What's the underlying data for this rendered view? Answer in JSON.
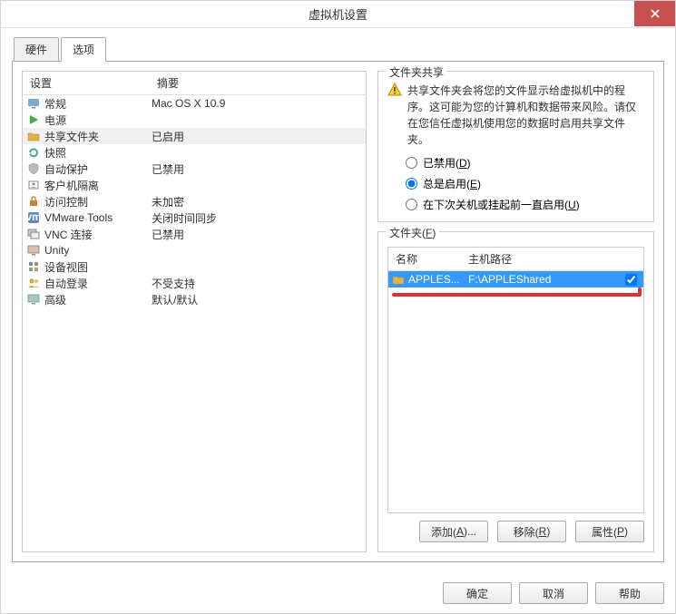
{
  "window": {
    "title": "虚拟机设置"
  },
  "tabs": {
    "hardware": "硬件",
    "options": "选项"
  },
  "columns": {
    "setting": "设置",
    "summary": "摘要"
  },
  "settings": [
    {
      "icon": "monitor",
      "label": "常规",
      "summary": "Mac OS X 10.9"
    },
    {
      "icon": "play",
      "label": "电源",
      "summary": ""
    },
    {
      "icon": "folder",
      "label": "共享文件夹",
      "summary": "已启用",
      "selected": true
    },
    {
      "icon": "snap",
      "label": "快照",
      "summary": ""
    },
    {
      "icon": "shield",
      "label": "自动保护",
      "summary": "已禁用"
    },
    {
      "icon": "guest",
      "label": "客户机隔离",
      "summary": ""
    },
    {
      "icon": "lock",
      "label": "访问控制",
      "summary": "未加密"
    },
    {
      "icon": "vmw",
      "label": "VMware Tools",
      "summary": "关闭时间同步"
    },
    {
      "icon": "vnc",
      "label": "VNC 连接",
      "summary": "已禁用"
    },
    {
      "icon": "unity",
      "label": "Unity",
      "summary": ""
    },
    {
      "icon": "dev",
      "label": "设备视图",
      "summary": ""
    },
    {
      "icon": "user",
      "label": "自动登录",
      "summary": "不受支持"
    },
    {
      "icon": "adv",
      "label": "高级",
      "summary": "默认/默认"
    }
  ],
  "share": {
    "group_title": "文件夹共享",
    "warning": "共享文件夹会将您的文件显示给虚拟机中的程序。这可能为您的计算机和数据带来风险。请仅在您信任虚拟机使用您的数据时启用共享文件夹。",
    "radios": {
      "disabled": {
        "label": "已禁用(",
        "key": "D",
        "suffix": ")"
      },
      "always": {
        "label": "总是启用(",
        "key": "E",
        "suffix": ")"
      },
      "until": {
        "label": "在下次关机或挂起前一直启用(",
        "key": "U",
        "suffix": ")"
      }
    },
    "selected": "always"
  },
  "folders": {
    "group_title": "文件夹(",
    "group_key": "F",
    "group_suffix": ")",
    "columns": {
      "name": "名称",
      "path": "主机路径"
    },
    "rows": [
      {
        "name": "APPLES...",
        "path": "F:\\APPLEShared",
        "checked": true
      }
    ],
    "buttons": {
      "add": {
        "label": "添加(",
        "key": "A",
        "suffix": ")..."
      },
      "remove": {
        "label": "移除(",
        "key": "R",
        "suffix": ")"
      },
      "props": {
        "label": "属性(",
        "key": "P",
        "suffix": ")"
      }
    }
  },
  "dialog_buttons": {
    "ok": "确定",
    "cancel": "取消",
    "help": "帮助"
  }
}
